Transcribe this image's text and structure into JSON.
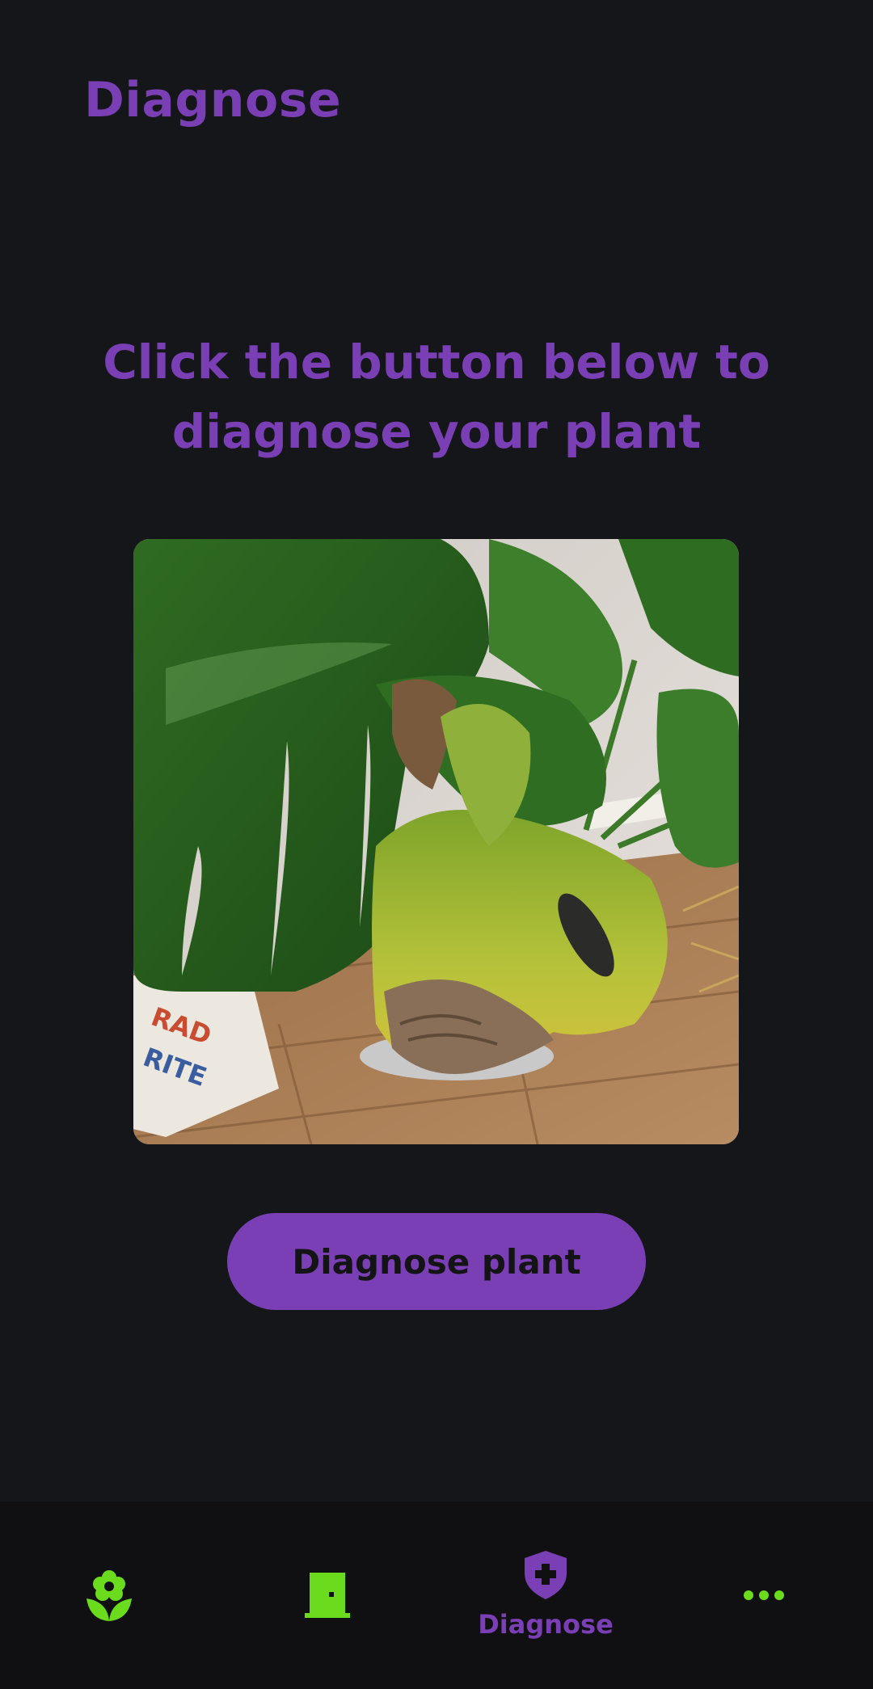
{
  "header": {
    "title": "Diagnose"
  },
  "main": {
    "prompt_line1": "Click the button below to",
    "prompt_line2": "diagnose your plant",
    "photo_alt": "Monstera plant with browning yellow leaves",
    "button_label": "Diagnose plant"
  },
  "bottom_nav": {
    "items": [
      {
        "icon": "flower-icon",
        "label": "",
        "active": false
      },
      {
        "icon": "door-icon",
        "label": "",
        "active": false
      },
      {
        "icon": "shield-plus-icon",
        "label": "Diagnose",
        "active": true
      },
      {
        "icon": "more-dots-icon",
        "label": "",
        "active": false
      }
    ]
  },
  "colors": {
    "background": "#151619",
    "nav_background": "#101012",
    "accent_purple": "#7a3fb4",
    "icon_green": "#6bdc1d",
    "button_text": "#141416"
  }
}
